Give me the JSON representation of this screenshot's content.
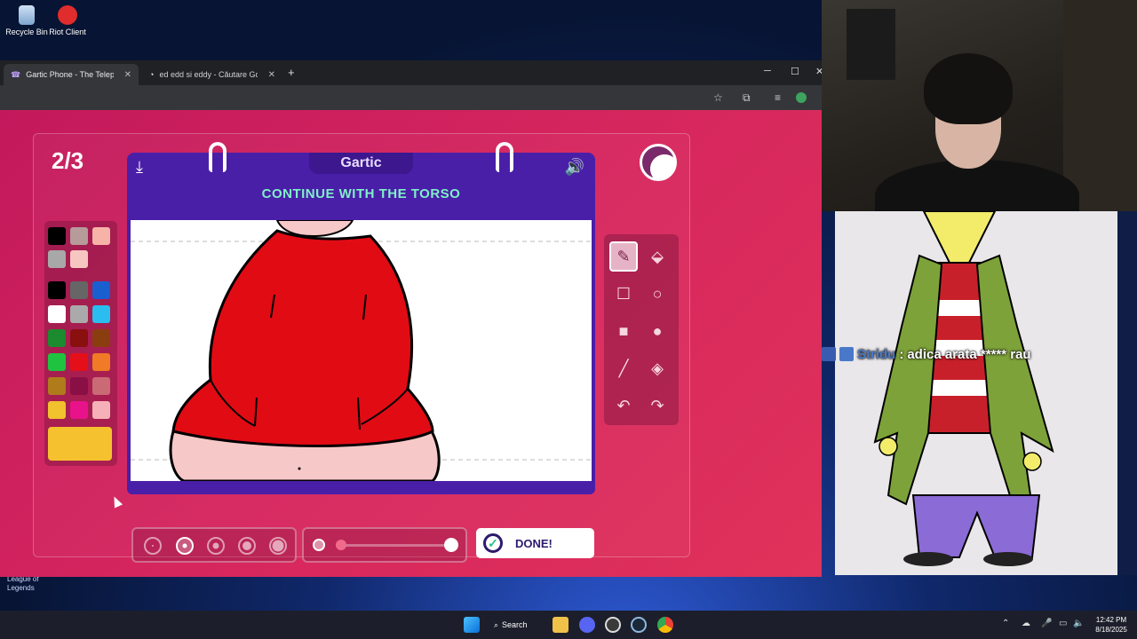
{
  "desktop": {
    "icons": [
      {
        "label": "Recycle Bin"
      },
      {
        "label": "Riot Client"
      }
    ],
    "lol_label": "League of Legends"
  },
  "browser": {
    "tabs": [
      {
        "title": "Gartic Phone - The Telephone G"
      },
      {
        "title": "ed edd si eddy - Căutare Googl"
      }
    ]
  },
  "game": {
    "round": "2/3",
    "logo": "Gartic",
    "prompt": "CONTINUE WITH THE TORSO",
    "done_label": "DONE!",
    "palette_colors": [
      "#000000",
      "#b79a9a",
      "#f7b3a8",
      "#a8a8a8",
      "#f6c6c1",
      "#000000",
      "#666666",
      "#1a5fd0",
      "#ffffff",
      "#aaaaaa",
      "#29bdf0",
      "#1c8a2f",
      "#8a0f0f",
      "#8a3e10",
      "#1fc340",
      "#e50f1a",
      "#f07a26",
      "#b07b1a",
      "#8a0f45",
      "#c96a74",
      "#f2c12e",
      "#e8128a",
      "#f6b0b8"
    ],
    "selected_color": "#f6c12e"
  },
  "stream": {
    "chat_name": "Stridu",
    "chat_message": "adica arata ***** rau"
  },
  "taskbar": {
    "search_label": "Search",
    "time": "12:42 PM",
    "date": "8/18/2025"
  }
}
